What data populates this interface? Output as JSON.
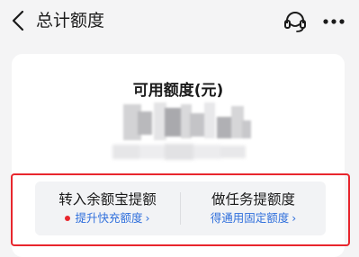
{
  "header": {
    "title": "总计额度",
    "back_icon": "chevron-left-icon",
    "service_icon": "customer-service-headset-icon",
    "more_icon": "more-dots-icon"
  },
  "card": {
    "credit_label": "可用额度(元)",
    "amount_masked": true
  },
  "actions": [
    {
      "title": "转入余额宝提额",
      "subtitle": "提升快充额度",
      "chevron": "›",
      "has_red_dot": true
    },
    {
      "title": "做任务提额度",
      "subtitle": "得通用固定额度",
      "chevron": "›",
      "has_red_dot": false
    }
  ],
  "colors": {
    "background": "#f4f4f5",
    "card": "#ffffff",
    "highlight": "#e8262d",
    "link": "#2f6fdc",
    "panel": "#f2f3f5"
  }
}
